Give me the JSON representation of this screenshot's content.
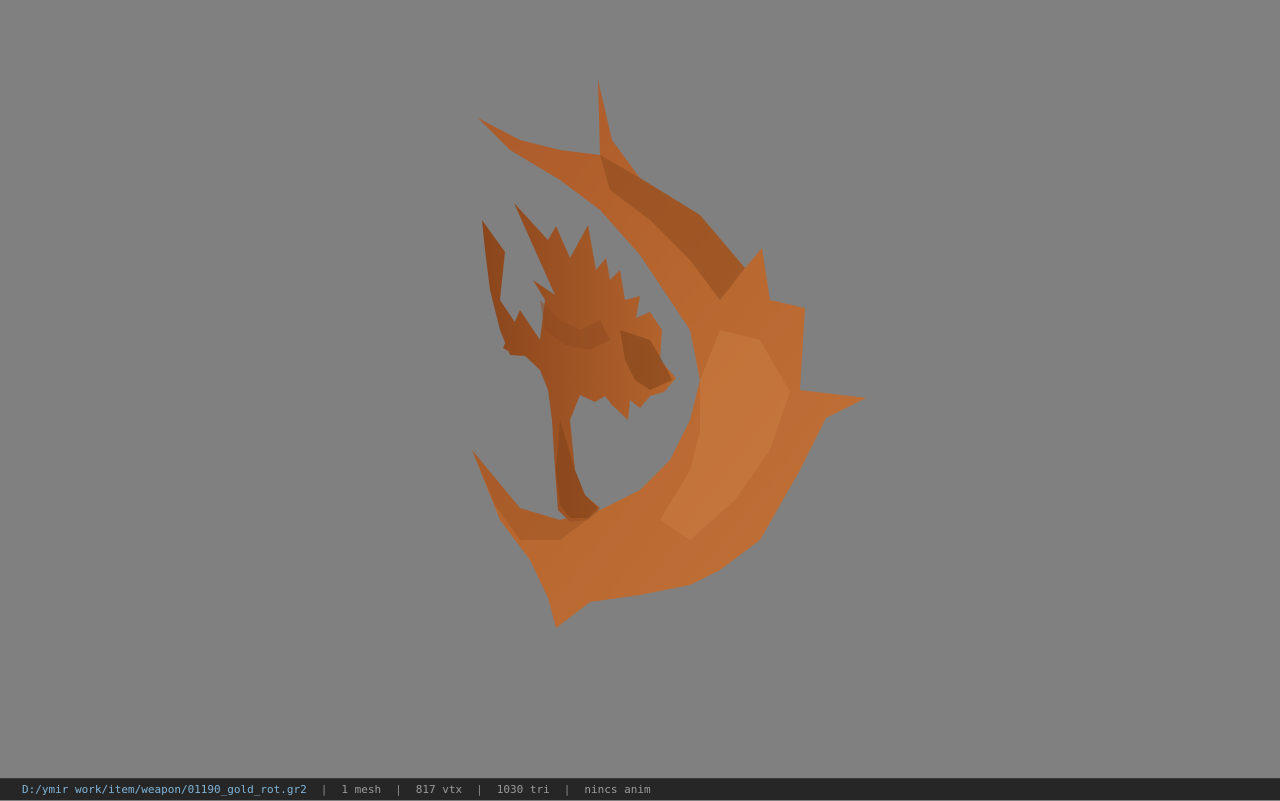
{
  "viewport": {
    "background": "#808080",
    "model_color": "#b5652e",
    "model_shadow_color": "#7a3d16",
    "model_highlight_color": "#c97a3f"
  },
  "statusbar": {
    "file_path": "D:/ymir work/item/weapon/01190_gold_rot.gr2",
    "mesh_count": "1 mesh",
    "vertex_count": "817 vtx",
    "triangle_count": "1030 tri",
    "animation": "nincs anim",
    "separator": "|"
  }
}
